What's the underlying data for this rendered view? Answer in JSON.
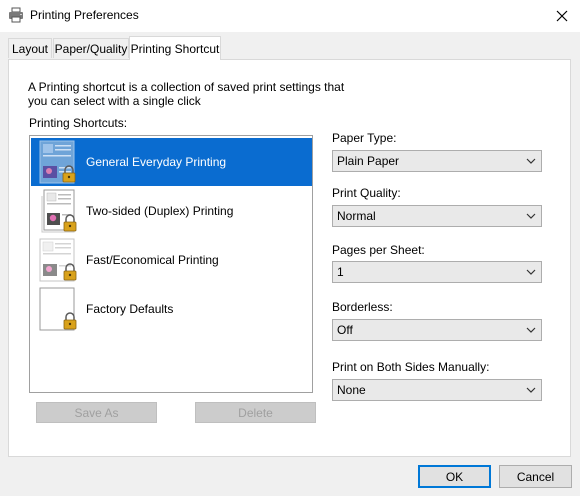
{
  "window": {
    "title": "Printing Preferences"
  },
  "tabs": [
    {
      "label": "Layout",
      "active": false
    },
    {
      "label": "Paper/Quality",
      "active": false
    },
    {
      "label": "Printing Shortcut",
      "active": true
    }
  ],
  "description": "A Printing shortcut is a collection of saved print settings that you can select with a single click",
  "shortcuts": {
    "label": "Printing Shortcuts:",
    "items": [
      {
        "label": "General Everyday Printing",
        "selected": true,
        "icon": "general-document-icon"
      },
      {
        "label": "Two-sided (Duplex) Printing",
        "selected": false,
        "icon": "duplex-document-icon"
      },
      {
        "label": "Fast/Economical Printing",
        "selected": false,
        "icon": "economy-document-icon"
      },
      {
        "label": "Factory Defaults",
        "selected": false,
        "icon": "blank-document-icon"
      }
    ]
  },
  "settings": {
    "paper_type": {
      "label": "Paper Type:",
      "value": "Plain Paper"
    },
    "print_quality": {
      "label": "Print Quality:",
      "value": "Normal"
    },
    "pages_per_sheet": {
      "label": "Pages per Sheet:",
      "value": "1"
    },
    "borderless": {
      "label": "Borderless:",
      "value": "Off"
    },
    "print_both_sides": {
      "label": "Print on Both Sides Manually:",
      "value": "None"
    }
  },
  "buttons": {
    "save_as": "Save As",
    "delete": "Delete",
    "ok": "OK",
    "cancel": "Cancel"
  },
  "colors": {
    "selection": "#0a6cd0",
    "accent": "#0078d7",
    "lock": "#d9a21b"
  }
}
